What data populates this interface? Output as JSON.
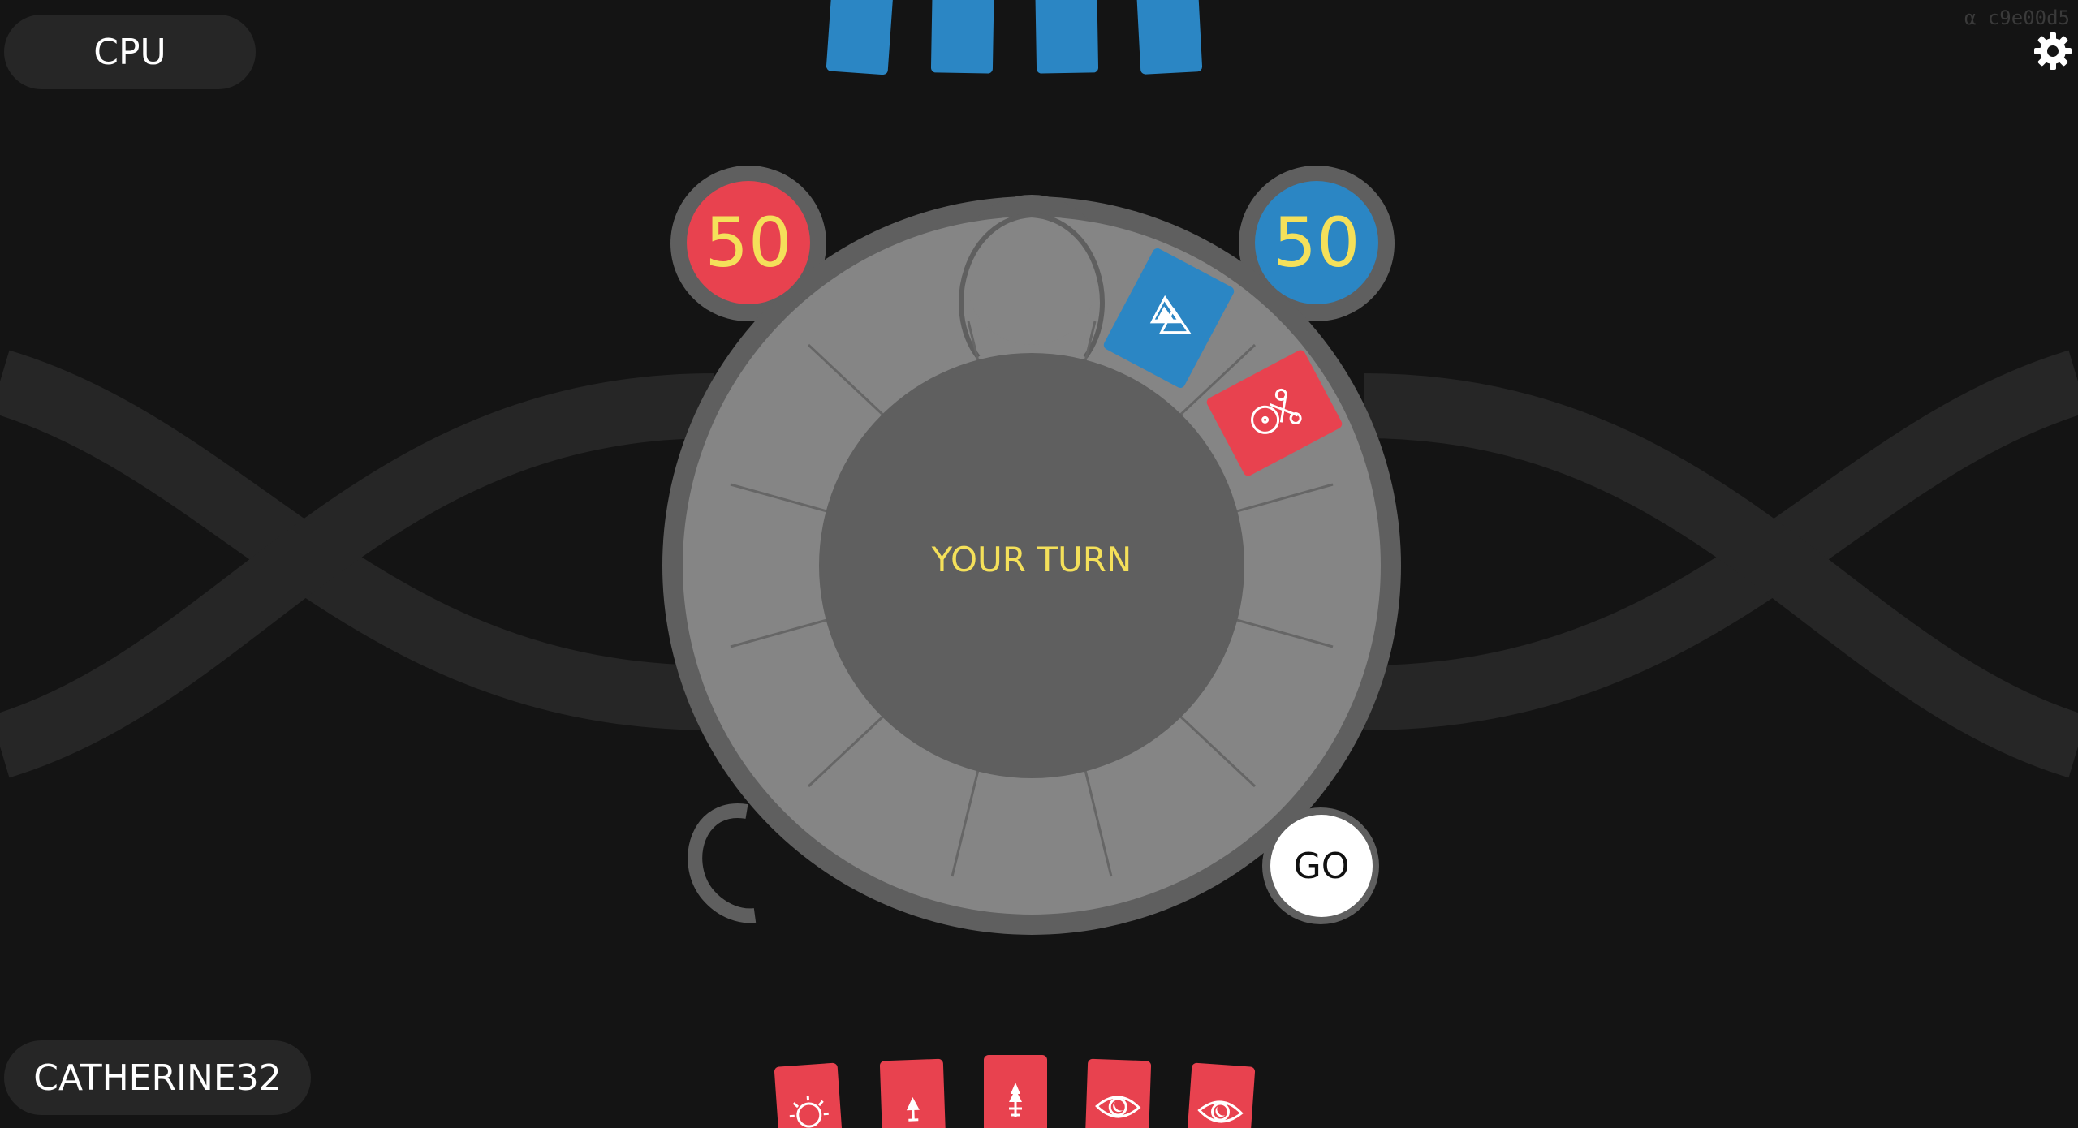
{
  "players": {
    "opponent_name": "CPU",
    "player_name": "CATHERINE32"
  },
  "scores": {
    "red": "50",
    "blue": "50"
  },
  "status": {
    "turn_text": "YOUR TURN"
  },
  "controls": {
    "go_label": "GO"
  },
  "version": {
    "label": "α c9e00d5"
  },
  "opponent_hand": {
    "count": 4,
    "color": "#2b86c4"
  },
  "player_hand": {
    "color": "#e8424f",
    "cards": [
      {
        "icon": "sun-icon"
      },
      {
        "icon": "small-tree-icon"
      },
      {
        "icon": "pine-tree-icon"
      },
      {
        "icon": "eye-icon"
      },
      {
        "icon": "eye-icon"
      }
    ]
  },
  "table_cards": [
    {
      "owner": "blue",
      "icon": "triangles-icon"
    },
    {
      "owner": "red",
      "icon": "scissors-icon"
    }
  ],
  "colors": {
    "background": "#141414",
    "ring": "#858585",
    "ring_border": "#5f5f5f",
    "center": "#5f5f5f",
    "red": "#e8424f",
    "blue": "#2b86c4",
    "accent_text": "#f4e05a"
  }
}
